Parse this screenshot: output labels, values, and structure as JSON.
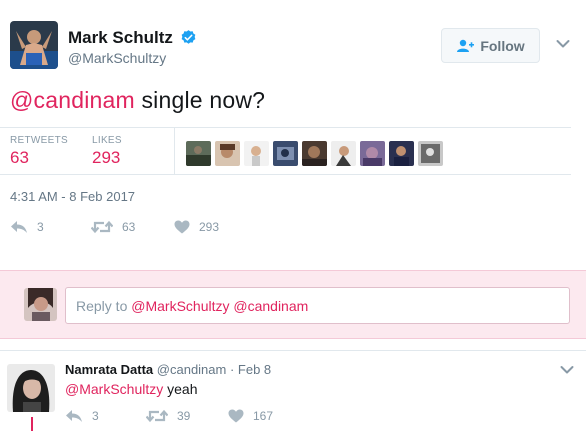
{
  "tweet": {
    "author_name": "Mark Schultz",
    "author_handle": "@MarkSchultzy",
    "verified_icon": "verified-badge-icon",
    "follow_label": "Follow",
    "text_mention": "@candinam",
    "text_rest": " single now?",
    "stats": {
      "retweets_label": "RETWEETS",
      "retweets_value": "63",
      "likes_label": "LIKES",
      "likes_value": "293",
      "liker_count": 9
    },
    "timestamp": "4:31 AM - 8 Feb 2017",
    "actions": {
      "reply_count": "3",
      "retweet_count": "63",
      "like_count": "293"
    }
  },
  "reply_box": {
    "placeholder_prefix": "Reply to ",
    "placeholder_mentions": "@MarkSchultzy @candinam"
  },
  "reply_tweet": {
    "author_name": "Namrata Datta",
    "author_handle": "@candinam",
    "separator": " · ",
    "date": "Feb 8",
    "text_mention": "@MarkSchultzy",
    "text_rest": " yeah",
    "actions": {
      "reply_count": "3",
      "retweet_count": "39",
      "like_count": "167"
    }
  },
  "colors": {
    "accent": "#e0245e",
    "muted": "#657786",
    "verified": "#1da1f2",
    "reply_zone_bg": "#fce9ef"
  }
}
